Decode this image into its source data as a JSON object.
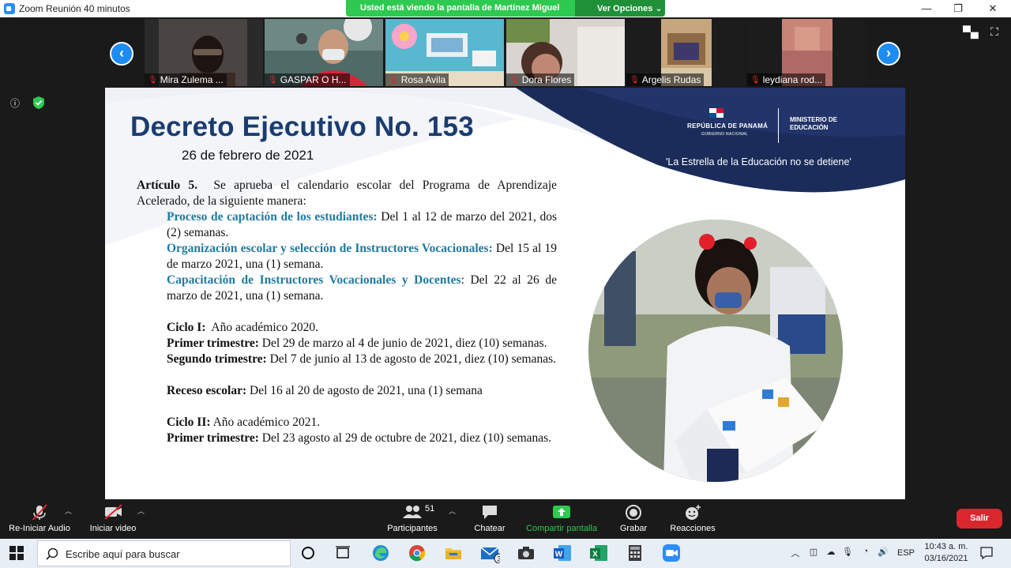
{
  "window": {
    "title": "Zoom Reunión 40 minutos",
    "share_banner": "Usted está viendo la pantalla de Martínez Miguel",
    "view_options": "Ver Opciones"
  },
  "participants": [
    {
      "name": "Mira Zulema ..."
    },
    {
      "name": "GASPAR O H..."
    },
    {
      "name": "Rosa Avila"
    },
    {
      "name": "Dora Flores"
    },
    {
      "name": "Argelis Rudas"
    },
    {
      "name": "leydiana rod..."
    }
  ],
  "slide": {
    "title": "Decreto Ejecutivo No. 153",
    "date": "26 de febrero de 2021",
    "logo_republic": "REPÚBLICA DE PANAMÁ",
    "logo_government": "GOBIERNO NACIONAL",
    "logo_ministry_line1": "MINISTERIO DE",
    "logo_ministry_line2": "EDUCACIÓN",
    "slogan": "'La Estrella de la Educación no se detiene'",
    "article_label": "Artículo 5.",
    "article_text": "Se aprueba el calendario escolar del Programa de Aprendizaje Acelerado, de la siguiente manera:",
    "item1_title": "Proceso de captación de los estudiantes:",
    "item1_text": "Del 1 al 12 de marzo del 2021, dos (2) semanas.",
    "item2_title": "Organización escolar y selección de Instructores Vocacionales:",
    "item2_text": "Del 15 al 19 de marzo 2021, una (1) semana.",
    "item3_title": "Capacitación de Instructores Vocacionales y Docentes",
    "item3_text": ": Del 22 al 26 de marzo de 2021, una (1) semana.",
    "ciclo1_label": "Ciclo I:",
    "ciclo1_text": "Año académico 2020.",
    "c1_t1_label": "Primer trimestre:",
    "c1_t1_text": "Del 29 de marzo al 4 de junio de 2021, diez (10) semanas.",
    "c1_t2_label": "Segundo trimestre:",
    "c1_t2_text": "Del 7 de junio al 13 de agosto de 2021, diez (10) semanas.",
    "receso_label": "Receso escolar:",
    "receso_text": "Del 16 al 20 de agosto de 2021, una (1) semana",
    "ciclo2_label": "Ciclo II:",
    "ciclo2_text": "Año académico 2021.",
    "c2_t1_label": "Primer trimestre:",
    "c2_t1_text": "Del 23 agosto al 29 de octubre de 2021, diez (10) semanas."
  },
  "toolbar": {
    "audio": "Re-Iniciar Audio",
    "video": "Iniciar video",
    "participants": "Participantes",
    "participants_count": "51",
    "chat": "Chatear",
    "share": "Compartir pantalla",
    "record": "Grabar",
    "reactions": "Reacciones",
    "leave": "Salir"
  },
  "taskbar": {
    "search_placeholder": "Escribe aquí para buscar",
    "mail_badge": "3",
    "language": "ESP",
    "time": "10:43 a. m.",
    "date": "03/16/2021"
  },
  "colors": {
    "zoom_blue": "#1e8cf0",
    "share_green": "#2ec950",
    "leave_red": "#d9272e",
    "slide_navy": "#1b3c6e",
    "highlight_teal": "#1f7aa0"
  }
}
